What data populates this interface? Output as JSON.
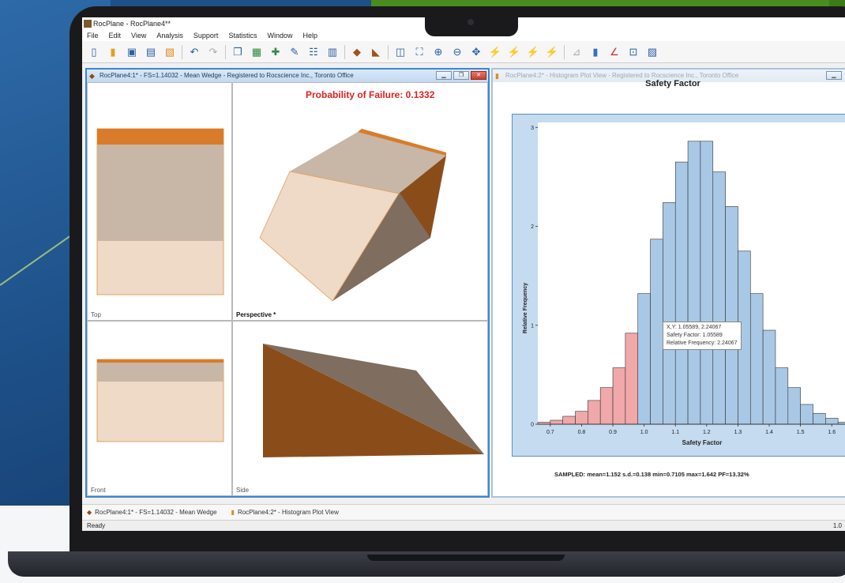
{
  "app": {
    "title": "RocPlane - RocPlane4**",
    "menu": [
      "File",
      "Edit",
      "View",
      "Analysis",
      "Support",
      "Statistics",
      "Window",
      "Help"
    ]
  },
  "wedge_window": {
    "title": "RocPlane4:1* - FS=1.14032 - Mean Wedge - Registered to Rocscience Inc., Toronto Office",
    "pf_label": "Probability of Failure: 0.1332",
    "panes": {
      "top": "Top",
      "perspective": "Perspective *",
      "front": "Front",
      "side": "Side"
    },
    "colors": {
      "face_light": "#efd9c7",
      "face_mid": "#c8b6a6",
      "face_top": "#d87c2a",
      "face_dark": "#8a4d1a"
    }
  },
  "histogram_window": {
    "title": "RocPlane4:2* - Histogram Plot View - Registered to Rocscience Inc., Toronto Office",
    "footer": "SAMPLED: mean=1.152 s.d.=0.138 min=0.7105 max=1.642 PF=13.32%",
    "tooltip": {
      "line1": "X,Y:   1.05589, 2.24067",
      "line2": "Safety Factor:   1.05589",
      "line3": "Relative Frequency:   2.24067"
    }
  },
  "chart_data": {
    "type": "bar",
    "title": "Safety Factor",
    "xlabel": "Safety Factor",
    "ylabel": "Relative Frequency",
    "xlim": [
      0.66,
      1.66
    ],
    "ylim": [
      0,
      3.05
    ],
    "xticks": [
      "0.7",
      "0.8",
      "0.9",
      "1.0",
      "1.1",
      "1.2",
      "1.3",
      "1.4",
      "1.5",
      "1.6"
    ],
    "yticks": [
      "0",
      "1",
      "2",
      "3"
    ],
    "bin_width": 0.04,
    "failure_threshold": 1.0,
    "bins": [
      {
        "x": 0.68,
        "y": 0.02
      },
      {
        "x": 0.72,
        "y": 0.04
      },
      {
        "x": 0.76,
        "y": 0.08
      },
      {
        "x": 0.8,
        "y": 0.13
      },
      {
        "x": 0.84,
        "y": 0.24
      },
      {
        "x": 0.88,
        "y": 0.37
      },
      {
        "x": 0.92,
        "y": 0.57
      },
      {
        "x": 0.96,
        "y": 0.92
      },
      {
        "x": 1.0,
        "y": 1.32
      },
      {
        "x": 1.04,
        "y": 1.87
      },
      {
        "x": 1.08,
        "y": 2.24
      },
      {
        "x": 1.12,
        "y": 2.65
      },
      {
        "x": 1.16,
        "y": 2.86
      },
      {
        "x": 1.2,
        "y": 2.86
      },
      {
        "x": 1.24,
        "y": 2.55
      },
      {
        "x": 1.28,
        "y": 2.2
      },
      {
        "x": 1.32,
        "y": 1.75
      },
      {
        "x": 1.36,
        "y": 1.32
      },
      {
        "x": 1.4,
        "y": 0.95
      },
      {
        "x": 1.44,
        "y": 0.57
      },
      {
        "x": 1.48,
        "y": 0.37
      },
      {
        "x": 1.52,
        "y": 0.2
      },
      {
        "x": 1.56,
        "y": 0.11
      },
      {
        "x": 1.6,
        "y": 0.06
      },
      {
        "x": 1.64,
        "y": 0.02
      }
    ],
    "colors": {
      "pass": "#a9c8e6",
      "fail": "#f0a8aa",
      "edge": "#333333",
      "plot_bg": "#ffffff",
      "frame_bg": "#c5dbef"
    }
  },
  "tabs": [
    {
      "label": "RocPlane4:1* - FS=1.14032 - Mean Wedge"
    },
    {
      "label": "RocPlane4:2* - Histogram Plot View"
    }
  ],
  "status": {
    "left": "Ready",
    "right": "1.0"
  }
}
